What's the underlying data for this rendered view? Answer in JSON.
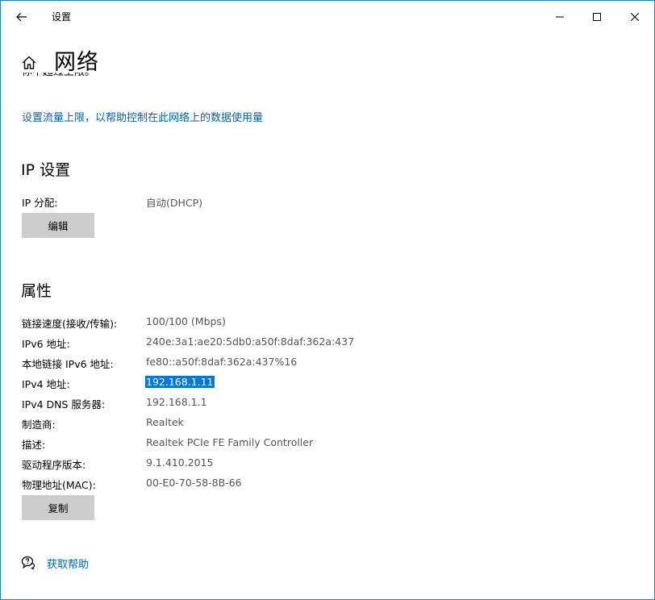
{
  "titlebar": {
    "title": "设置",
    "back_icon": "back-arrow-icon",
    "minimize_icon": "minimize-icon",
    "maximize_icon": "maximize-icon",
    "close_icon": "close-icon"
  },
  "header": {
    "home_icon": "home-icon",
    "title": "网络",
    "clipped_text": "你不超过上限。"
  },
  "data_limit": {
    "link_text": "设置流量上限，以帮助控制在此网络上的数据使用量"
  },
  "ip_settings": {
    "title": "IP 设置",
    "assignment_label": "IP 分配:",
    "assignment_value": "自动(DHCP)",
    "edit_button": "编辑"
  },
  "properties": {
    "title": "属性",
    "rows": [
      {
        "label": "链接速度(接收/传输):",
        "value": "100/100 (Mbps)"
      },
      {
        "label": "IPv6 地址:",
        "value": "240e:3a1:ae20:5db0:a50f:8daf:362a:437"
      },
      {
        "label": "本地链接 IPv6 地址:",
        "value": "fe80::a50f:8daf:362a:437%16"
      },
      {
        "label": "IPv4 地址:",
        "value": "192.168.1.11"
      },
      {
        "label": "IPv4 DNS 服务器:",
        "value": "192.168.1.1"
      },
      {
        "label": "制造商:",
        "value": "Realtek"
      },
      {
        "label": "描述:",
        "value": "Realtek PCIe FE Family Controller"
      },
      {
        "label": "驱动程序版本:",
        "value": "9.1.410.2015"
      },
      {
        "label": "物理地址(MAC):",
        "value": "00-E0-70-58-8B-66"
      }
    ],
    "copy_button": "复制"
  },
  "help": {
    "icon": "help-chat-icon",
    "link_text": "获取帮助"
  },
  "colors": {
    "accent": "#0063b1",
    "selection": "#0078d7",
    "button_bg": "#cccccc",
    "window_border": "#1883d7"
  }
}
